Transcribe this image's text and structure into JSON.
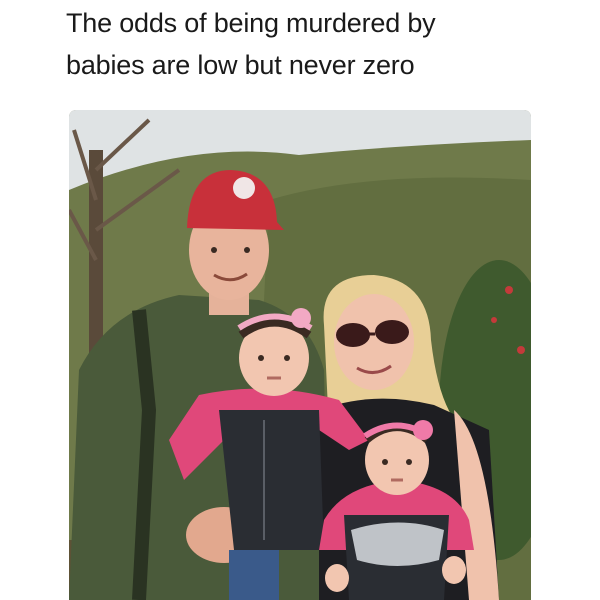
{
  "caption": {
    "line1": "The odds of being murdered by",
    "line2": "babies are low but never zero"
  },
  "photo": {
    "alt": "Family photo: man in red cap and green jacket, blonde woman in sunglasses, two babies in carriers with pink headbands, outdoors on a wooded hillside",
    "colors": {
      "sky": "#dfe3e4",
      "hill": "#6f7a4a",
      "cap": "#c8303a",
      "jacket": "#4a5a3a",
      "baby_top": "#e0487a",
      "carrier": "#2a2d33",
      "hair": "#e8cf96"
    }
  }
}
